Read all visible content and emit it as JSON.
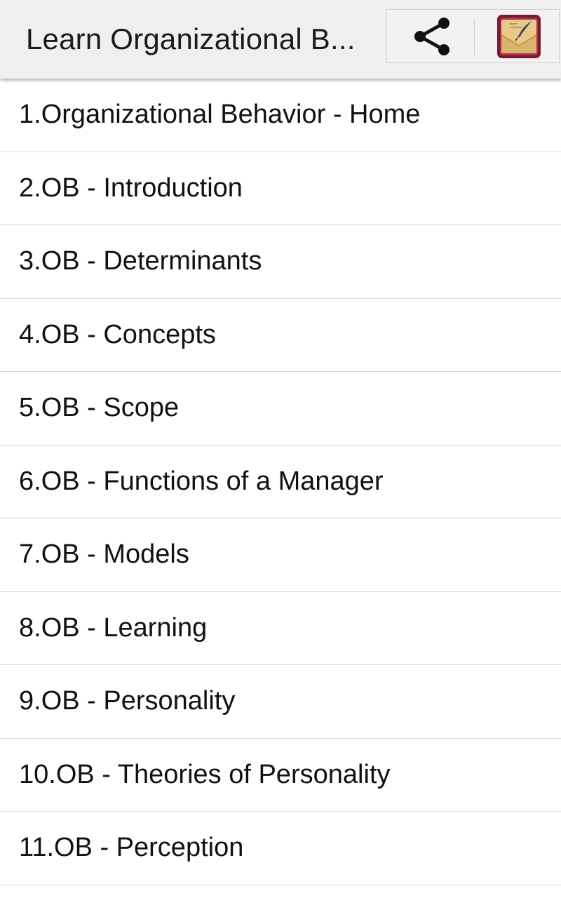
{
  "app_bar": {
    "title": "Learn Organizational B...",
    "share_icon": "share-icon",
    "app_icon": "letter-quill-icon"
  },
  "colors": {
    "app_bar_bg": "#efefef",
    "app_icon_frame": "#7a1a2e",
    "app_icon_paper": "#e8c98a"
  },
  "topics": [
    {
      "label": "1.Organizational Behavior - Home"
    },
    {
      "label": "2.OB - Introduction"
    },
    {
      "label": "3.OB - Determinants"
    },
    {
      "label": "4.OB - Concepts"
    },
    {
      "label": "5.OB - Scope"
    },
    {
      "label": "6.OB - Functions of a Manager"
    },
    {
      "label": "7.OB - Models"
    },
    {
      "label": "8.OB - Learning"
    },
    {
      "label": "9.OB - Personality"
    },
    {
      "label": "10.OB - Theories of Personality"
    },
    {
      "label": "11.OB - Perception"
    }
  ]
}
